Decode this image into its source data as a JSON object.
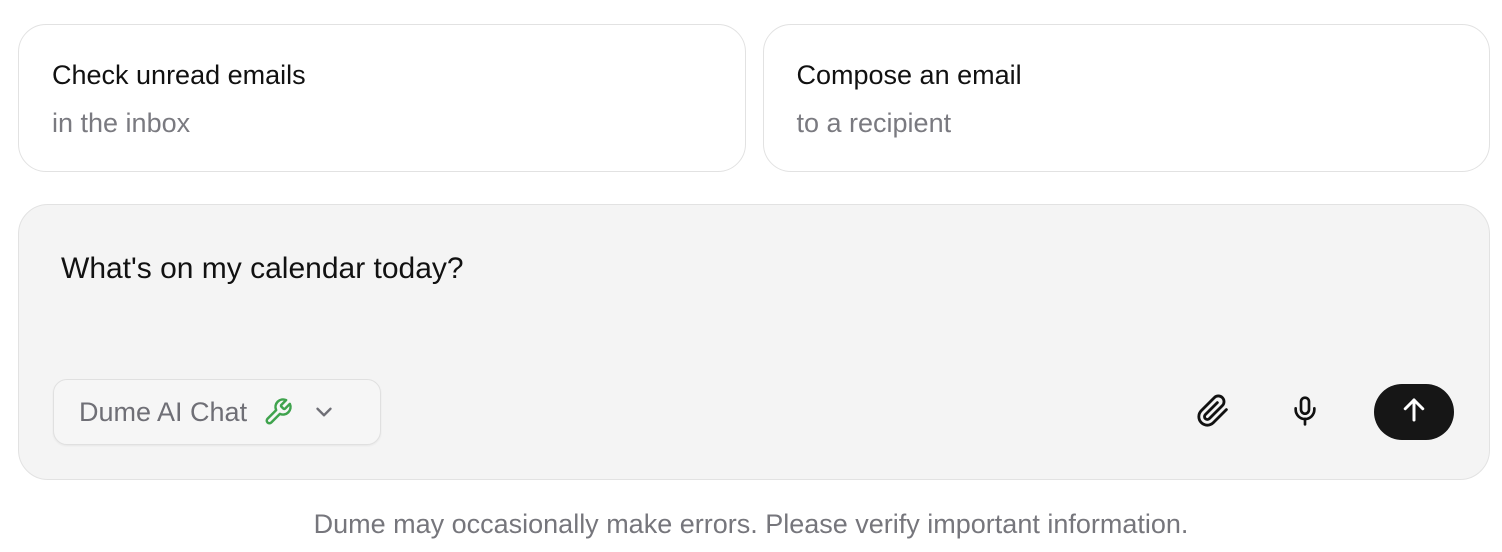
{
  "suggestions": [
    {
      "title": "Check unread emails",
      "subtitle": "in the inbox"
    },
    {
      "title": "Compose an email",
      "subtitle": "to a recipient"
    }
  ],
  "composer": {
    "input_value": "What's on my calendar today?",
    "model_label": "Dume AI Chat",
    "model_icon": "wrench-icon",
    "model_icon_color": "#3fa34d",
    "dropdown_icon": "chevron-down-icon",
    "attach_icon": "paperclip-icon",
    "mic_icon": "microphone-icon",
    "send_icon": "arrow-up-icon",
    "send_button_color": "#161616"
  },
  "footer": {
    "disclaimer": "Dume may occasionally make errors. Please verify important information."
  }
}
